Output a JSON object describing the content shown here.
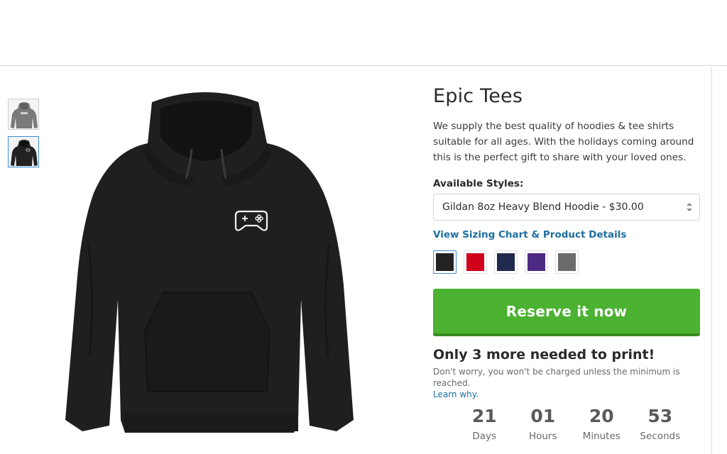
{
  "gallery": {
    "thumbnails": [
      {
        "color": "gray",
        "hex": "#7a7a7a"
      },
      {
        "color": "black",
        "hex": "#222222"
      }
    ],
    "active_index": 1
  },
  "product": {
    "title": "Epic Tees",
    "description": "We supply the best quality of hoodies & tee shirts suitable for all ages. With the holidays coming around this is the perfect gift to share with your loved ones.",
    "styles_label": "Available Styles:",
    "selected_style": "Gildan 8oz Heavy Blend Hoodie - $30.00",
    "sizing_link": "View Sizing Chart & Product Details",
    "swatches": [
      {
        "name": "black",
        "hex": "#222222",
        "selected": true
      },
      {
        "name": "red",
        "hex": "#d0011b"
      },
      {
        "name": "navy",
        "hex": "#1f2a4d"
      },
      {
        "name": "purple",
        "hex": "#4d2a83"
      },
      {
        "name": "gray",
        "hex": "#6b6b6b"
      }
    ],
    "reserve_button": "Reserve it now",
    "needed_text": "Only 3 more needed to print!",
    "note_text": "Don't worry, you won't be charged unless the minimum is reached.",
    "learn_link": "Learn why."
  },
  "countdown": {
    "days": "21",
    "days_label": "Days",
    "hours": "01",
    "hours_label": "Hours",
    "minutes": "20",
    "minutes_label": "Minutes",
    "seconds": "53",
    "seconds_label": "Seconds"
  },
  "colors": {
    "accent_green": "#4cb231",
    "link_blue": "#1d6f9f",
    "hoodie": "#1f1f1f"
  }
}
